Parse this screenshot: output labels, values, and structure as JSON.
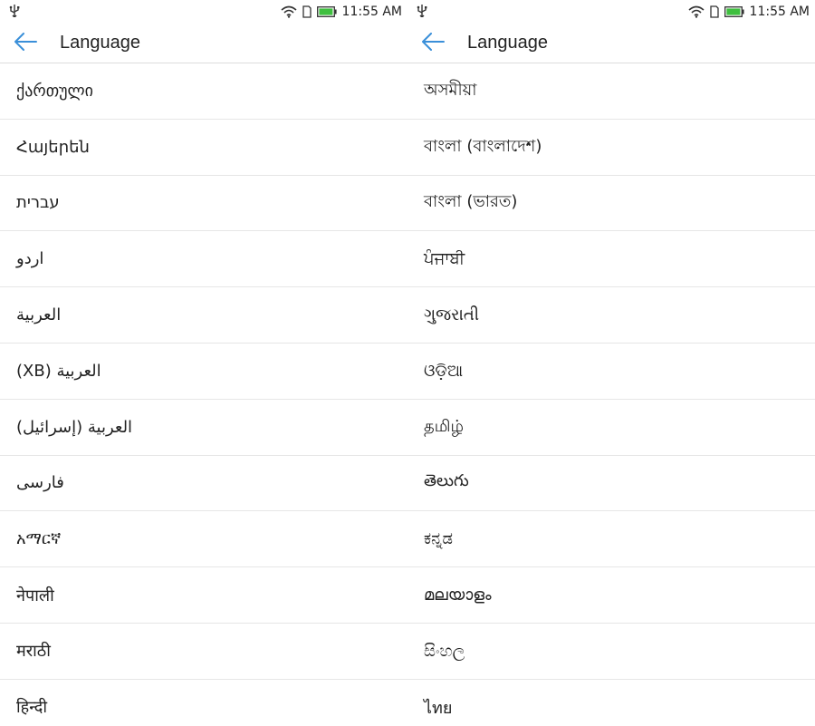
{
  "status": {
    "time": "11:55 AM",
    "icons": [
      "usb-icon",
      "wifi-icon",
      "sim-icon",
      "battery-icon"
    ],
    "battery_color": "#3fbf3f"
  },
  "accent_color": "#3a8fd9",
  "left_screen": {
    "title": "Language",
    "items": [
      {
        "label": "ქართული",
        "rtl": false
      },
      {
        "label": "Հայերեն",
        "rtl": false
      },
      {
        "label": "עברית",
        "rtl": true
      },
      {
        "label": "اردو",
        "rtl": true
      },
      {
        "label": "العربية",
        "rtl": true
      },
      {
        "label": "العربية (XB)",
        "rtl": true
      },
      {
        "label": "العربية (إسرائيل)",
        "rtl": true
      },
      {
        "label": "فارسی",
        "rtl": true
      },
      {
        "label": "አማርኛ",
        "rtl": false
      },
      {
        "label": "नेपाली",
        "rtl": false
      },
      {
        "label": "मराठी",
        "rtl": false
      },
      {
        "label": "हिन्दी",
        "rtl": false
      }
    ]
  },
  "right_screen": {
    "title": "Language",
    "items": [
      {
        "label": "অসমীয়া",
        "rtl": false
      },
      {
        "label": "বাংলা (বাংলাদেশ)",
        "rtl": false
      },
      {
        "label": "বাংলা (ভারত)",
        "rtl": false
      },
      {
        "label": "ਪੰਜਾਬੀ",
        "rtl": false
      },
      {
        "label": "ગુજરાતી",
        "rtl": false
      },
      {
        "label": "ଓଡ଼ିଆ",
        "rtl": false
      },
      {
        "label": "தமிழ்",
        "rtl": false
      },
      {
        "label": "తెలుగు",
        "rtl": false
      },
      {
        "label": "ಕನ್ನಡ",
        "rtl": false
      },
      {
        "label": "മലയാളം",
        "rtl": false
      },
      {
        "label": "සිංහල",
        "rtl": false
      },
      {
        "label": "ไทย",
        "rtl": false
      }
    ]
  }
}
